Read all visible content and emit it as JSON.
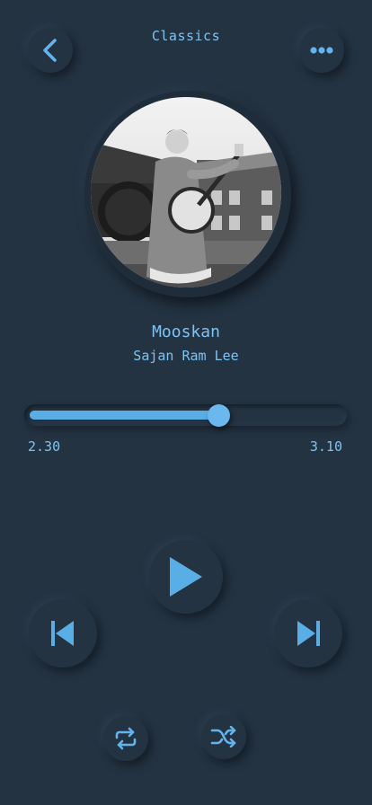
{
  "header": {
    "title": "Classics",
    "back_icon": "chevron-left-icon",
    "menu_icon": "more-horizontal-icon"
  },
  "track": {
    "title": "Mooskan",
    "artist": "Sajan Ram Lee",
    "elapsed": "2.30",
    "duration": "3.10",
    "progress": 0.61
  },
  "controls": {
    "play_icon": "play-icon",
    "prev_icon": "skip-previous-icon",
    "next_icon": "skip-next-icon",
    "repeat_icon": "repeat-icon",
    "shuffle_icon": "shuffle-icon"
  },
  "colors": {
    "background": "#243342",
    "accent": "#7cc3f2",
    "progress_fill": "#5aaee6"
  }
}
